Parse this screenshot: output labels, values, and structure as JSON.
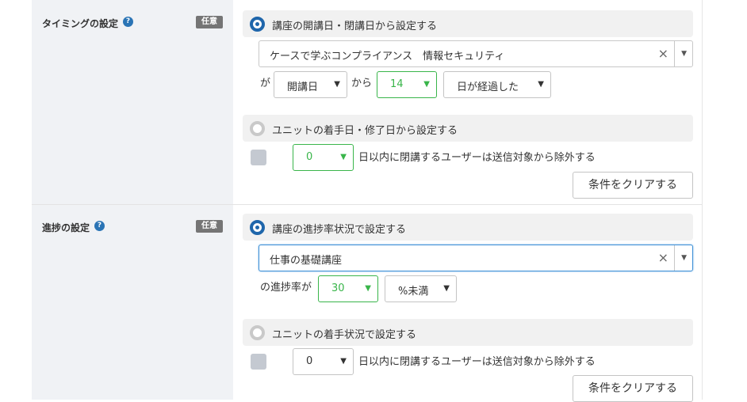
{
  "timing": {
    "title": "タイミングの設定",
    "help_icon": "?",
    "badge": "任意",
    "option1_label": "講座の開講日・閉講日から設定する",
    "course_value": "ケースで学ぶコンプライアンス　情報セキュリティ",
    "clear_icon": "×",
    "caret_icon": "▼",
    "prefix": "が",
    "event_value": "開講日",
    "kara": "から",
    "days_value": "14",
    "after_value": "日が経過した",
    "option2_label": "ユニットの着手日・修了日から設定する",
    "exclude_days_value": "0",
    "exclude_text": "日以内に閉講するユーザーは送信対象から除外する",
    "clear_button": "条件をクリアする"
  },
  "progress": {
    "title": "進捗の設定",
    "help_icon": "?",
    "badge": "任意",
    "option1_label": "講座の進捗率状況で設定する",
    "course_value": "仕事の基礎講座",
    "clear_icon": "×",
    "caret_icon": "▼",
    "rate_prefix": "の進捗率が",
    "rate_value": "30",
    "compare_value": "%未満",
    "option2_label": "ユニットの着手状況で設定する",
    "exclude_days_value": "0",
    "exclude_text": "日以内に閉講するユーザーは送信対象から除外する",
    "clear_button": "条件をクリアする"
  },
  "colors": {
    "accent_blue": "#1f66ab",
    "green": "#39b54a",
    "label_bg": "#f0f2f5"
  }
}
